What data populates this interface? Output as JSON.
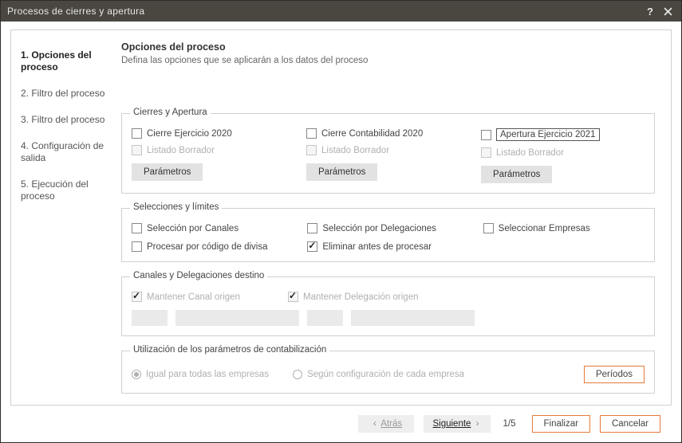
{
  "window": {
    "title": "Procesos de cierres y apertura"
  },
  "header": {
    "title": "Opciones del proceso",
    "subtitle": "Defina las opciones que se aplicarán a los datos del proceso"
  },
  "steps": [
    {
      "label": "1. Opciones del proceso",
      "current": true
    },
    {
      "label": "2. Filtro del proceso",
      "current": false
    },
    {
      "label": "3. Filtro del proceso",
      "current": false
    },
    {
      "label": "4. Configuración de salida",
      "current": false
    },
    {
      "label": "5. Ejecución del proceso",
      "current": false
    }
  ],
  "group_closes": {
    "legend": "Cierres y Apertura",
    "cols": [
      {
        "main": "Cierre Ejercicio 2020",
        "draft": "Listado Borrador",
        "btn": "Parámetros",
        "highlighted": false
      },
      {
        "main": "Cierre Contabilidad 2020",
        "draft": "Listado Borrador",
        "btn": "Parámetros",
        "highlighted": false
      },
      {
        "main": "Apertura Ejercicio 2021",
        "draft": "Listado Borrador",
        "btn": "Parámetros",
        "highlighted": true
      }
    ]
  },
  "group_limits": {
    "legend": "Selecciones y  límites",
    "sel_canales": "Selección por Canales",
    "sel_delegaciones": "Selección por Delegaciones",
    "sel_empresas": "Seleccionar Empresas",
    "proc_divisa": "Procesar por código de divisa",
    "elim_procesar": "Eliminar antes de procesar"
  },
  "group_dest": {
    "legend": "Canales y Delegaciones destino",
    "keep_canal": "Mantener Canal origen",
    "keep_deleg": "Mantener Delegación origen"
  },
  "group_util": {
    "legend": "Utilización de los parámetros de contabilización",
    "r_all": "Igual para todas las empresas",
    "r_each": "Según configuración de cada empresa",
    "btn_periods": "Períodos"
  },
  "footer": {
    "back": "Atrás",
    "next": "Siguiente",
    "page": "1/5",
    "finish": "Finalizar",
    "cancel": "Cancelar"
  }
}
